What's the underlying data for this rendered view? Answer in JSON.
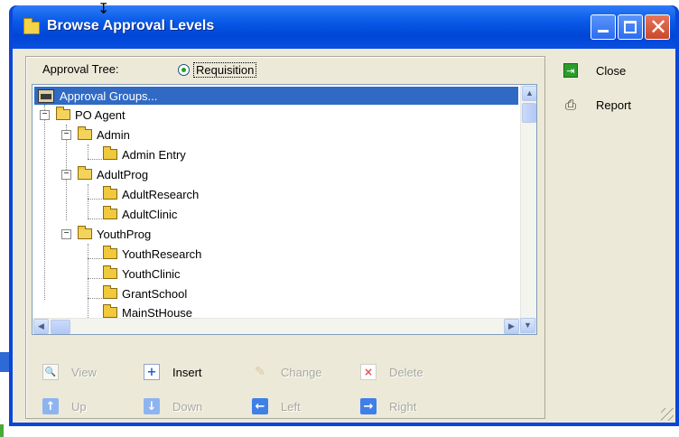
{
  "window": {
    "title": "Browse Approval Levels",
    "colors": {
      "titlebar": "#0a5ce8",
      "client": "#ece9d8",
      "selection": "#316ac5"
    }
  },
  "approval_tree": {
    "label": "Approval Tree:",
    "radio_label": "Requisition",
    "radio_selected": true
  },
  "tree": {
    "root": "Approval Groups...",
    "nodes": {
      "po_agent": "PO Agent",
      "admin": "Admin",
      "admin_entry": "Admin Entry",
      "adultprog": "AdultProg",
      "adultresearch": "AdultResearch",
      "adultclinic": "AdultClinic",
      "youthprog": "YouthProg",
      "youthresearch": "YouthResearch",
      "youthclinic": "YouthClinic",
      "grantschool": "GrantSchool",
      "mainsthouse": "MainStHouse"
    }
  },
  "actions": {
    "view": "View",
    "insert": "Insert",
    "change": "Change",
    "delete": "Delete",
    "up": "Up",
    "down": "Down",
    "left": "Left",
    "right": "Right"
  },
  "side": {
    "close": "Close",
    "report": "Report"
  },
  "icons": {
    "title": "folder-icon",
    "close": "exit-icon",
    "report": "printer-icon"
  }
}
